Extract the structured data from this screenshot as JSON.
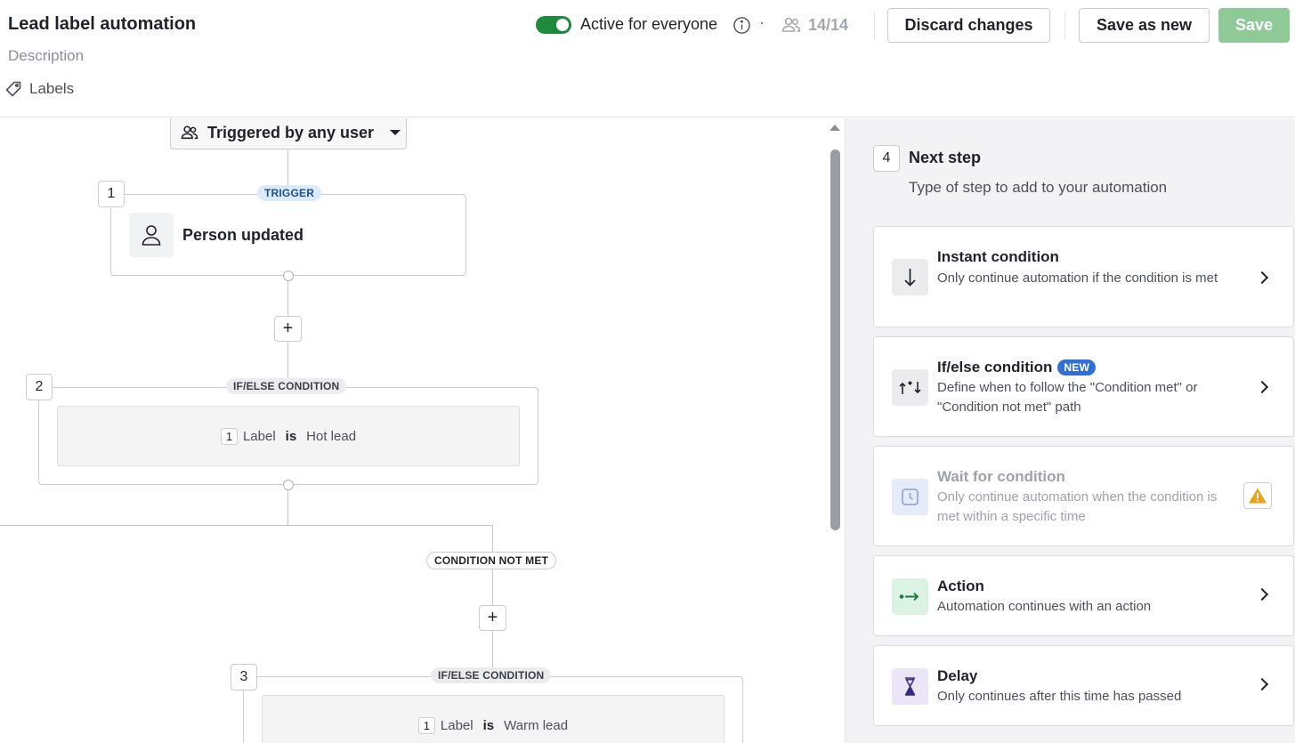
{
  "header": {
    "title": "Lead label automation",
    "description_placeholder": "Description",
    "labels_label": "Labels",
    "active_label": "Active for everyone",
    "separator": "·",
    "users_count": "14/14",
    "discard_label": "Discard changes",
    "save_as_new_label": "Save as new",
    "save_label": "Save"
  },
  "canvas": {
    "trigger_select": "Triggered by any user",
    "steps": [
      {
        "number": "1",
        "tag": "TRIGGER",
        "title": "Person updated"
      },
      {
        "number": "2",
        "tag": "IF/ELSE CONDITION",
        "condition": {
          "index": "1",
          "field": "Label",
          "operator": "is",
          "value": "Hot lead"
        }
      },
      {
        "number": "3",
        "tag": "IF/ELSE CONDITION",
        "condition": {
          "index": "1",
          "field": "Label",
          "operator": "is",
          "value": "Warm lead"
        }
      }
    ],
    "branch_label": "CONDITION NOT MET",
    "plus": "+"
  },
  "panel": {
    "step_number": "4",
    "title": "Next step",
    "subtitle": "Type of step to add to your automation",
    "options": [
      {
        "title": "Instant condition",
        "description": "Only continue automation if the condition is met",
        "icon": "arrow-down-icon",
        "icon_bg": "#ececee"
      },
      {
        "title": "If/else condition",
        "badge": "NEW",
        "description": "Define when to follow the \"Condition met\" or \"Condition not met\" path",
        "icon": "branch-arrows-icon",
        "icon_bg": "#ececee"
      },
      {
        "title": "Wait for condition",
        "description": "Only continue automation when the condition is met within a specific time",
        "icon": "clock-icon",
        "icon_bg": "#e6ebfa",
        "disabled": true
      },
      {
        "title": "Action",
        "description": "Automation continues with an action",
        "icon": "action-arrow-icon",
        "icon_bg": "#dcf3e4"
      },
      {
        "title": "Delay",
        "description": "Only continues after this time has passed",
        "icon": "hourglass-icon",
        "icon_bg": "#ebe6f7"
      }
    ]
  },
  "colors": {
    "accent_green": "#1f8a3c",
    "save_disabled": "#8fc997",
    "new_badge": "#2f6fd6",
    "warning": "#e8a317"
  }
}
